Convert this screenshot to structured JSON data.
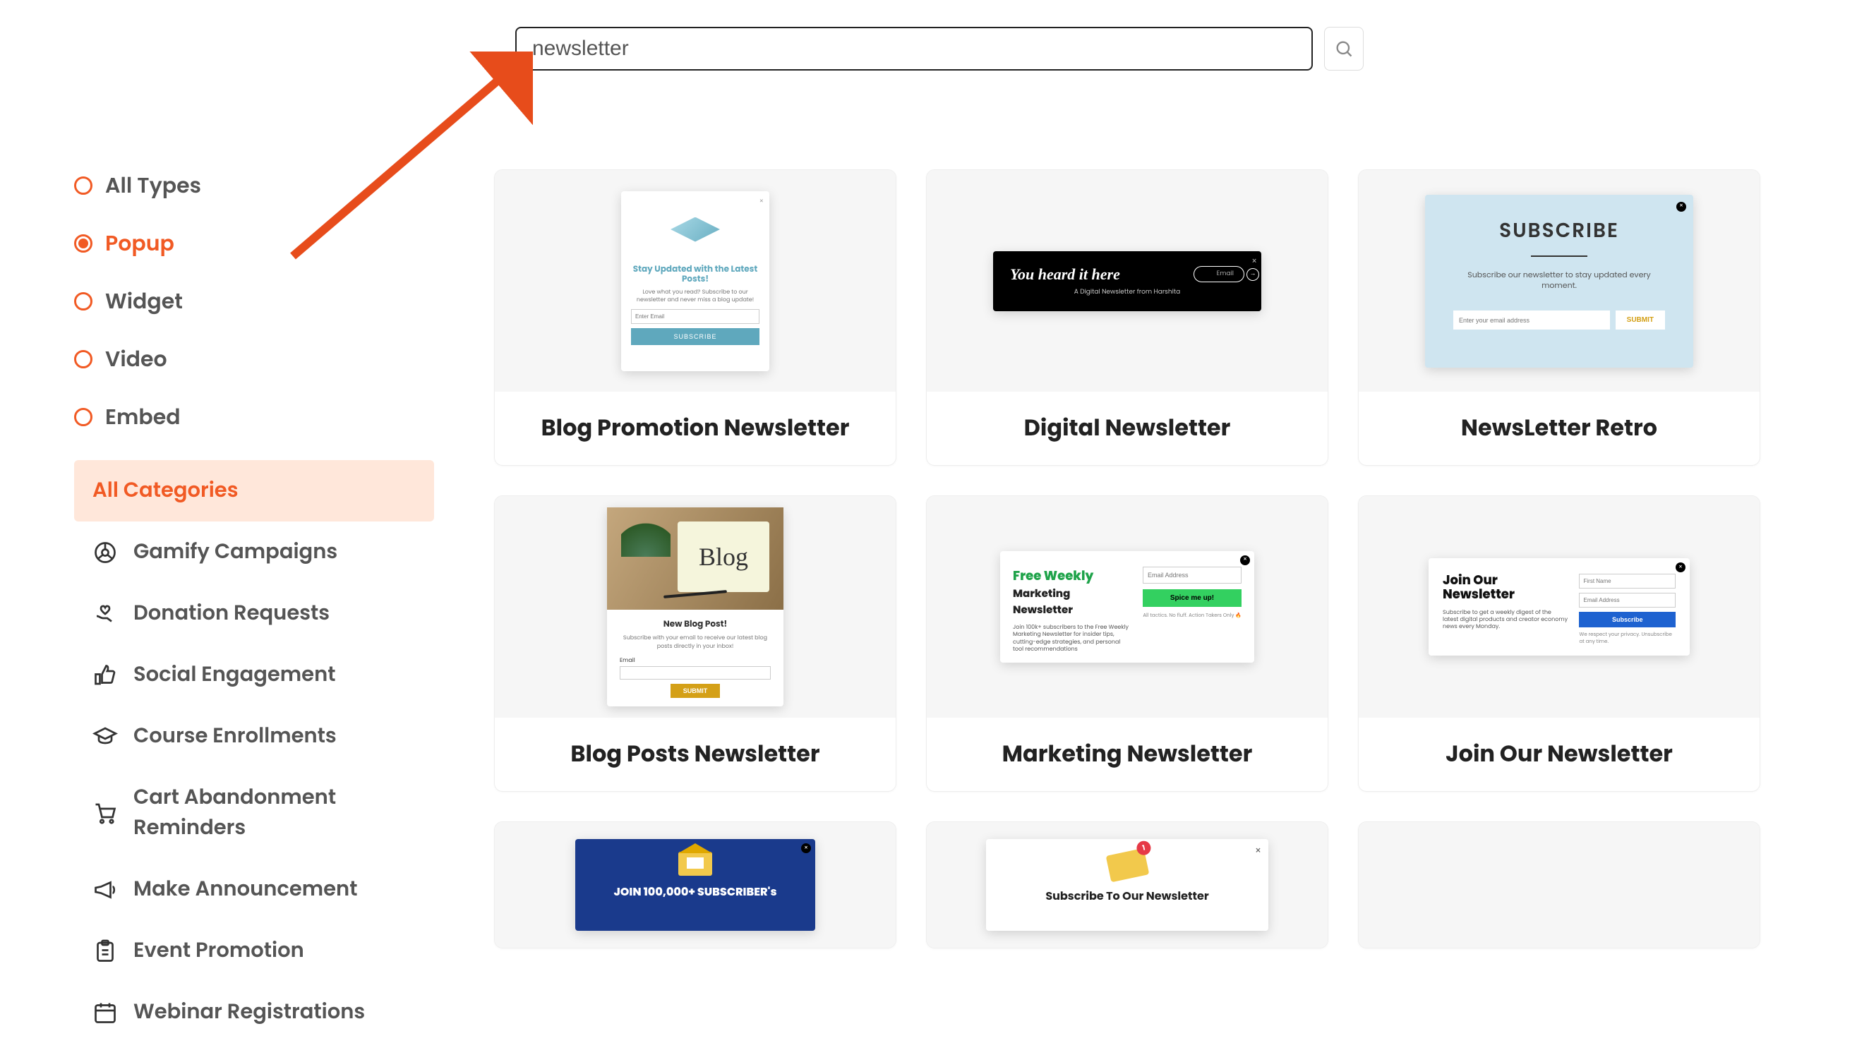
{
  "search": {
    "value": "newsletter"
  },
  "filters": {
    "types": [
      {
        "id": "all-types",
        "label": "All Types",
        "active": false
      },
      {
        "id": "popup",
        "label": "Popup",
        "active": true
      },
      {
        "id": "widget",
        "label": "Widget",
        "active": false
      },
      {
        "id": "video",
        "label": "Video",
        "active": false
      },
      {
        "id": "embed",
        "label": "Embed",
        "active": false
      }
    ],
    "categories": [
      {
        "id": "all-categories",
        "label": "All Categories",
        "active": true
      },
      {
        "id": "gamify",
        "label": "Gamify Campaigns",
        "active": false
      },
      {
        "id": "donation",
        "label": "Donation Requests",
        "active": false
      },
      {
        "id": "social",
        "label": "Social Engagement",
        "active": false
      },
      {
        "id": "courses",
        "label": "Course Enrollments",
        "active": false
      },
      {
        "id": "cart-abandon",
        "label": "Cart Abandonment Reminders",
        "active": false
      },
      {
        "id": "announcement",
        "label": "Make Announcement",
        "active": false
      },
      {
        "id": "event-promo",
        "label": "Event Promotion",
        "active": false
      },
      {
        "id": "webinar",
        "label": "Webinar Registrations",
        "active": false
      }
    ]
  },
  "templates": [
    {
      "id": "blog-promo",
      "title": "Blog Promotion Newsletter"
    },
    {
      "id": "digital",
      "title": "Digital Newsletter"
    },
    {
      "id": "retro",
      "title": "NewsLetter Retro"
    },
    {
      "id": "blog-posts",
      "title": "Blog Posts Newsletter"
    },
    {
      "id": "marketing",
      "title": "Marketing Newsletter"
    },
    {
      "id": "join-our",
      "title": "Join Our Newsletter"
    },
    {
      "id": "join-100k",
      "title": ""
    },
    {
      "id": "subscribe-to",
      "title": ""
    },
    {
      "id": "empty9",
      "title": ""
    }
  ],
  "preview": {
    "m1": {
      "heading": "Stay Updated with the Latest Posts!",
      "sub": "Love what you read? Subscribe to our newsletter and never miss a blog update!",
      "placeholder": "Enter Email",
      "btn": "SUBSCRIBE"
    },
    "m2": {
      "heading": "You heard it here",
      "pill": "Email",
      "sub": "A Digital Newsletter from Harshita"
    },
    "m3": {
      "heading": "SUBSCRIBE",
      "sub": "Subscribe our newsletter to stay updated every moment.",
      "placeholder": "Enter your email address",
      "btn": "SUBMIT"
    },
    "m4": {
      "script": "Blog",
      "heading": "New Blog Post!",
      "sub": "Subscribe with your email to receive our latest blog posts directly in your inbox!",
      "label": "Email",
      "btn": "SUBMIT"
    },
    "m5": {
      "h1": "Free Weekly",
      "h2": "Marketing Newsletter",
      "sub": "Join 100k+ subscribers to the Free Weekly Marketing Newsletter for insider tips, cutting-edge strategies, and personal tool recommendations",
      "placeholder": "Email Address",
      "btn": "Spice me up!",
      "foot": "All tactics. No fluff. Action Takers Only 🔥"
    },
    "m6": {
      "heading": "Join Our Newsletter",
      "sub": "Subscribe to get a weekly digest of the latest digital products and creator economy  news every Monday.",
      "ph1": "First Name",
      "ph2": "Email Address",
      "btn": "Subscribe",
      "foot": "We respect your privacy. Unsubscribe at any time."
    },
    "m7": {
      "heading": "JOIN 100,000+ SUBSCRIBER's"
    },
    "m8": {
      "heading": "Subscribe To Our Newsletter",
      "badge": "1"
    }
  }
}
